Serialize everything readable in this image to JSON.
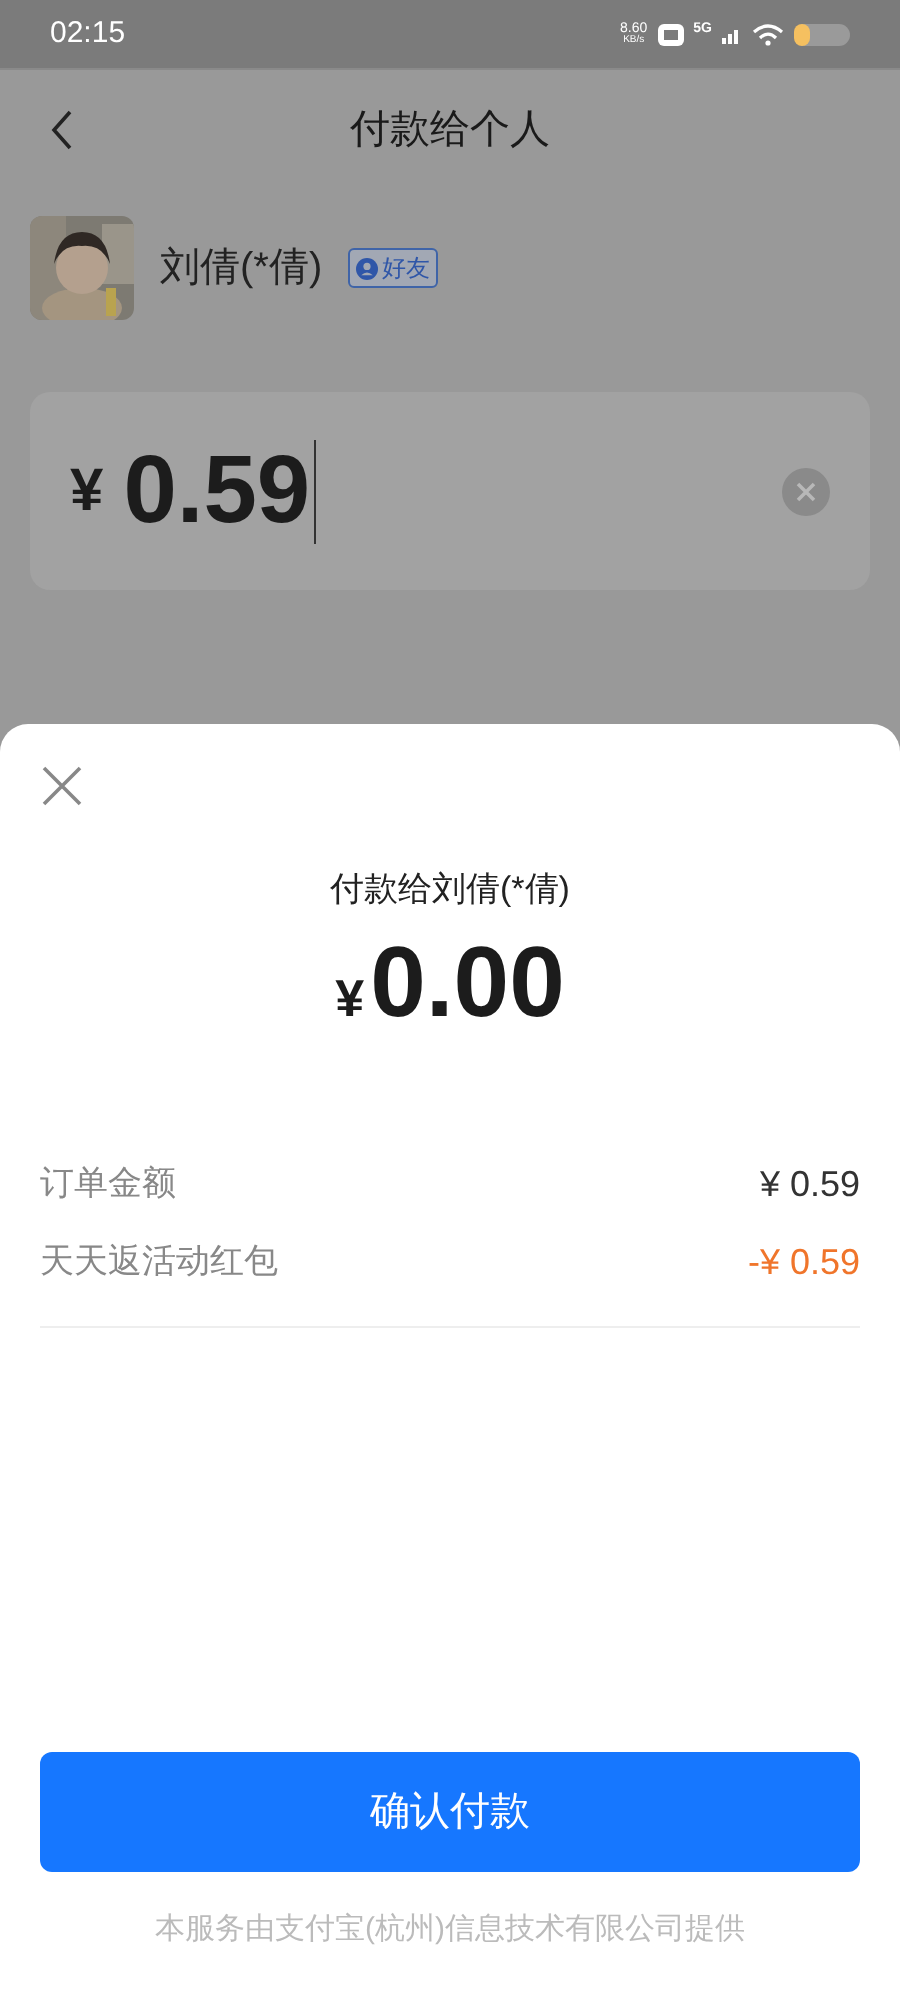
{
  "status_bar": {
    "time": "02:15",
    "speed": "8.60",
    "speed_unit": "KB/s",
    "network": "5G"
  },
  "header": {
    "title": "付款给个人"
  },
  "payee": {
    "name": "刘倩(*倩)",
    "badge": "好友"
  },
  "amount_field": {
    "currency": "¥",
    "value": "0.59"
  },
  "sheet": {
    "title": "付款给刘倩(*倩)",
    "currency": "¥",
    "amount": "0.00",
    "rows": [
      {
        "label": "订单金额",
        "value": "¥ 0.59",
        "color": "#333333"
      },
      {
        "label": "天天返活动红包",
        "value": "-¥ 0.59",
        "color": "#f0752b"
      }
    ],
    "confirm_button": "确认付款",
    "footer": "本服务由支付宝(杭州)信息技术有限公司提供"
  }
}
